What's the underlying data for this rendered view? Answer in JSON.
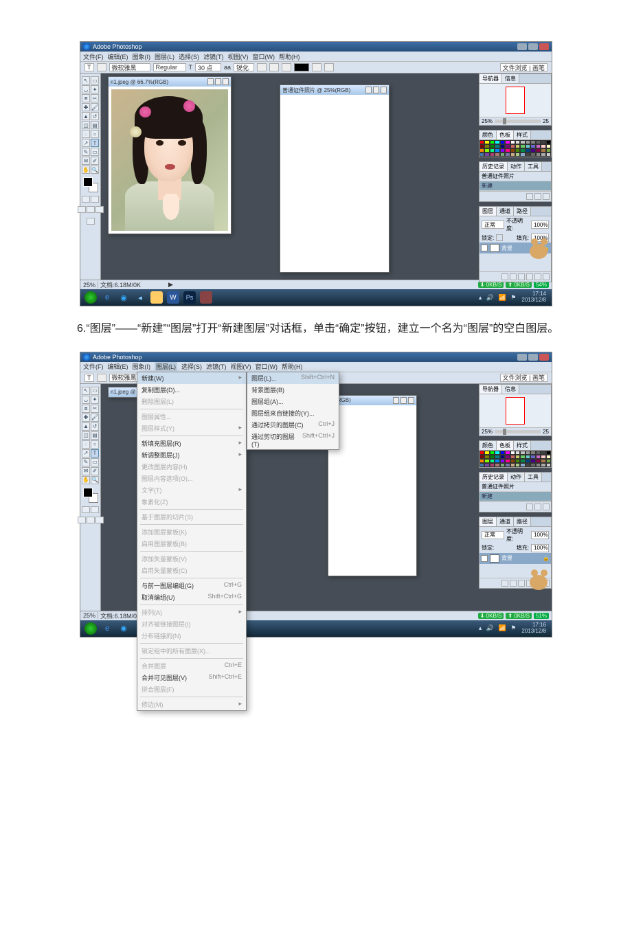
{
  "titlebar": {
    "appname": "Adobe Photoshop"
  },
  "menus": [
    "文件(F)",
    "编辑(E)",
    "图象(I)",
    "图层(L)",
    "选择(S)",
    "滤镜(T)",
    "视图(V)",
    "窗口(W)",
    "帮助(H)"
  ],
  "optionsbar": {
    "tool": "T",
    "font": "微软雅黑",
    "weight": "Regular",
    "size": "30 点",
    "aa": "锐化",
    "browsebtn": "文件浏览 | 画笔"
  },
  "docs": {
    "d1": {
      "title": "n1.jpeg @ 66.7%(RGB)"
    },
    "d2": {
      "title": "普通证件照片 @ 25%(RGB)"
    },
    "d1b": {
      "title": "n1.jpeg @"
    },
    "d2b": {
      "title": "%(RGB)"
    }
  },
  "nav": {
    "tab1": "导航器",
    "tab2": "信息",
    "zoom": "25%",
    "zoom2": "25"
  },
  "color": {
    "t1": "颜色",
    "t2": "色板",
    "t3": "样式"
  },
  "history": {
    "t1": "历史记录",
    "t2": "动作",
    "t3": "工具",
    "row1": "普通证件照片",
    "row2": "新建"
  },
  "layers": {
    "t1": "图层",
    "t2": "通道",
    "t3": "路径",
    "mode": "正常",
    "opacity_lbl": "不透明度:",
    "opacity": "100%",
    "lock": "锁定:",
    "fill_lbl": "填充:",
    "fill": "100%",
    "bg": "背景"
  },
  "status": {
    "zoom": "25%",
    "doc": "文档:6.18M/0K",
    "s0": "0KB/S",
    "s1": "0KB/S",
    "cpu1": "54%",
    "cpu2": "51%"
  },
  "tray": {
    "time1": "17:14",
    "date1": "2013/12/8",
    "time2": "17:16",
    "date2": "2013/12/8"
  },
  "para6": "6.“图层”——“新建”“图层”打开“新建图层”对话框，单击“确定”按钮，建立一个名为“图层”的空白图层。",
  "layer_menu": {
    "items": [
      {
        "label": "新建(W)",
        "arrow": "▸",
        "highlight": true
      },
      {
        "label": "复制图层(D)..."
      },
      {
        "label": "删除图层(L)",
        "disabled": true
      },
      {
        "sep": true
      },
      {
        "label": "图层属性...",
        "disabled": true
      },
      {
        "label": "图层样式(Y)",
        "arrow": "▸",
        "disabled": true
      },
      {
        "sep": true
      },
      {
        "label": "新填充图层(R)",
        "arrow": "▸"
      },
      {
        "label": "新调整图层(J)",
        "arrow": "▸"
      },
      {
        "label": "更改图层内容(H)",
        "disabled": true
      },
      {
        "label": "图层内容选项(O)...",
        "disabled": true
      },
      {
        "label": "文字(T)",
        "arrow": "▸",
        "disabled": true
      },
      {
        "label": "象素化(Z)",
        "disabled": true
      },
      {
        "sep": true
      },
      {
        "label": "基于图层的切片(S)",
        "disabled": true
      },
      {
        "sep": true
      },
      {
        "label": "添加图层蒙板(K)",
        "disabled": true
      },
      {
        "label": "启用图层蒙板(B)",
        "disabled": true
      },
      {
        "sep": true
      },
      {
        "label": "添加失量蒙板(V)",
        "disabled": true
      },
      {
        "label": "启用失量蒙板(C)",
        "disabled": true
      },
      {
        "sep": true
      },
      {
        "label": "与前一图层编组(G)",
        "key": "Ctrl+G"
      },
      {
        "label": "取消编组(U)",
        "key": "Shift+Ctrl+G"
      },
      {
        "sep": true
      },
      {
        "label": "排列(A)",
        "arrow": "▸",
        "disabled": true
      },
      {
        "label": "对齐被链接图层(I)",
        "disabled": true
      },
      {
        "label": "分布链接的(N)",
        "disabled": true
      },
      {
        "sep": true
      },
      {
        "label": "锁定组中的所有图层(X)...",
        "disabled": true
      },
      {
        "sep": true
      },
      {
        "label": "合并图层",
        "key": "Ctrl+E",
        "disabled": true
      },
      {
        "label": "合并可见图层(V)",
        "key": "Shift+Ctrl+E"
      },
      {
        "label": "拼合图层(F)",
        "disabled": true
      },
      {
        "sep": true
      },
      {
        "label": "修边(M)",
        "arrow": "▸",
        "disabled": true
      }
    ]
  },
  "new_submenu": {
    "items": [
      {
        "label": "图层(L)...",
        "key": "Shift+Ctrl+N",
        "highlight": true
      },
      {
        "label": "背景图层(B)"
      },
      {
        "label": "图层组(A)..."
      },
      {
        "label": "图层组来自链接的(Y)..."
      },
      {
        "sep": true
      },
      {
        "label": "通过拷贝的图层(C)",
        "key": "Ctrl+J"
      },
      {
        "label": "通过剪切的图层(T)",
        "key": "Shift+Ctrl+J"
      }
    ]
  },
  "swatch_colors": [
    "#ff0000",
    "#ffff00",
    "#00ff00",
    "#00ffff",
    "#0000ff",
    "#ff00ff",
    "#ffffff",
    "#e0e0e0",
    "#c0c0c0",
    "#a0a0a0",
    "#808080",
    "#606060",
    "#404040",
    "#000000",
    "#800000",
    "#808000",
    "#008000",
    "#008080",
    "#000080",
    "#800080",
    "#cc6666",
    "#cccc66",
    "#66cc66",
    "#66cccc",
    "#6666cc",
    "#cc66cc",
    "#ffcccc",
    "#ffffcc",
    "#ff8800",
    "#88ff00",
    "#00ff88",
    "#0088ff",
    "#8800ff",
    "#ff0088",
    "#884400",
    "#448800",
    "#008844",
    "#004488",
    "#440088",
    "#880044",
    "#aa7744",
    "#77aa44",
    "#4477aa",
    "#7744aa",
    "#aa4477",
    "#aa7777",
    "#77aa77",
    "#7777aa",
    "#ccaa88",
    "#aacc88",
    "#88aacc",
    "#444444",
    "#666666",
    "#888888",
    "#aaaaaa",
    "#cccccc"
  ]
}
